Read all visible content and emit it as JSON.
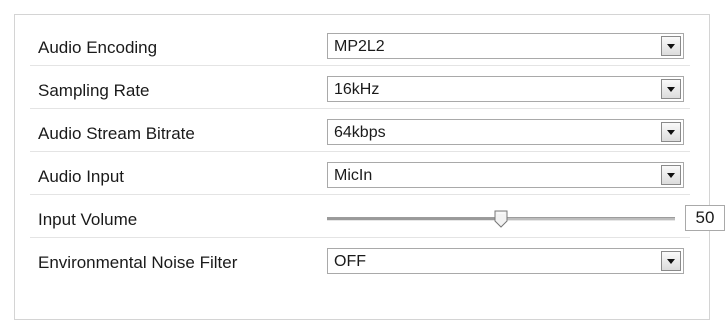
{
  "settings": {
    "rows": [
      {
        "label": "Audio Encoding",
        "value": "MP2L2",
        "type": "select"
      },
      {
        "label": "Sampling Rate",
        "value": "16kHz",
        "type": "select"
      },
      {
        "label": "Audio Stream Bitrate",
        "value": "64kbps",
        "type": "select"
      },
      {
        "label": "Audio Input",
        "value": "MicIn",
        "type": "select"
      },
      {
        "label": "Input Volume",
        "value": "50",
        "type": "slider",
        "level_percent": 50
      },
      {
        "label": "Environmental Noise Filter",
        "value": "OFF",
        "type": "select"
      }
    ]
  },
  "icons": {
    "dropdown": "chevron-down-icon",
    "slider_thumb": "slider-thumb-icon"
  },
  "colors": {
    "border": "#a9a9a9",
    "separator": "#e4e4e4",
    "text": "#1a1a1a"
  }
}
